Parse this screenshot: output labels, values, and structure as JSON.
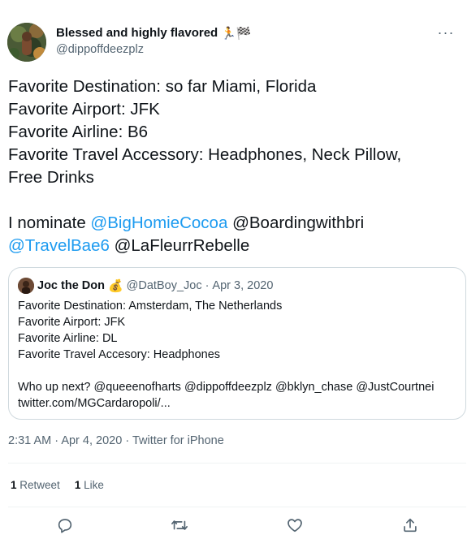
{
  "author": {
    "display_name": "Blessed and highly flavored",
    "name_emoji": "🏃🏁",
    "handle": "@dippoffdeezplz"
  },
  "tweet": {
    "lines": [
      "Favorite Destination: so far Miami, Florida",
      "Favorite Airport: JFK",
      "Favorite Airline: B6",
      "Favorite Travel Accessory: Headphones, Neck Pillow,",
      "Free Drinks"
    ],
    "nominate_prefix": "I nominate ",
    "mentions": [
      "@BigHomieCocoa",
      "@Boardingwithbri",
      "@TravelBae6",
      "@LaFleurrRebelle"
    ]
  },
  "quote": {
    "name": "Joc the Don",
    "name_emoji": "💰",
    "handle": "@DatBoy_Joc",
    "separator": "·",
    "date": "Apr 3, 2020",
    "lines": [
      "Favorite Destination: Amsterdam, The Netherlands",
      "Favorite Airport: JFK",
      "Favorite Airline: DL",
      "Favorite Travel Accesory: Headphones"
    ],
    "last_line": "Who up next? @queeenofharts @dippoffdeezplz @bklyn_chase @JustCourtnei",
    "link": "twitter.com/MGCardaropoli/..."
  },
  "meta": {
    "time": "2:31 AM",
    "separator": "·",
    "date": "Apr 4, 2020",
    "source": "Twitter for iPhone"
  },
  "stats": {
    "retweets_count": "1",
    "retweets_label": "Retweet",
    "likes_count": "1",
    "likes_label": "Like"
  },
  "icons": {
    "more": "more-icon",
    "reply": "reply-icon",
    "retweet": "retweet-icon",
    "like": "like-icon",
    "share": "share-icon"
  },
  "colors": {
    "accent": "#1d9bf0",
    "text": "#0f1419",
    "secondary": "#536471",
    "border": "#cfd9de",
    "divider": "#eff3f4"
  }
}
